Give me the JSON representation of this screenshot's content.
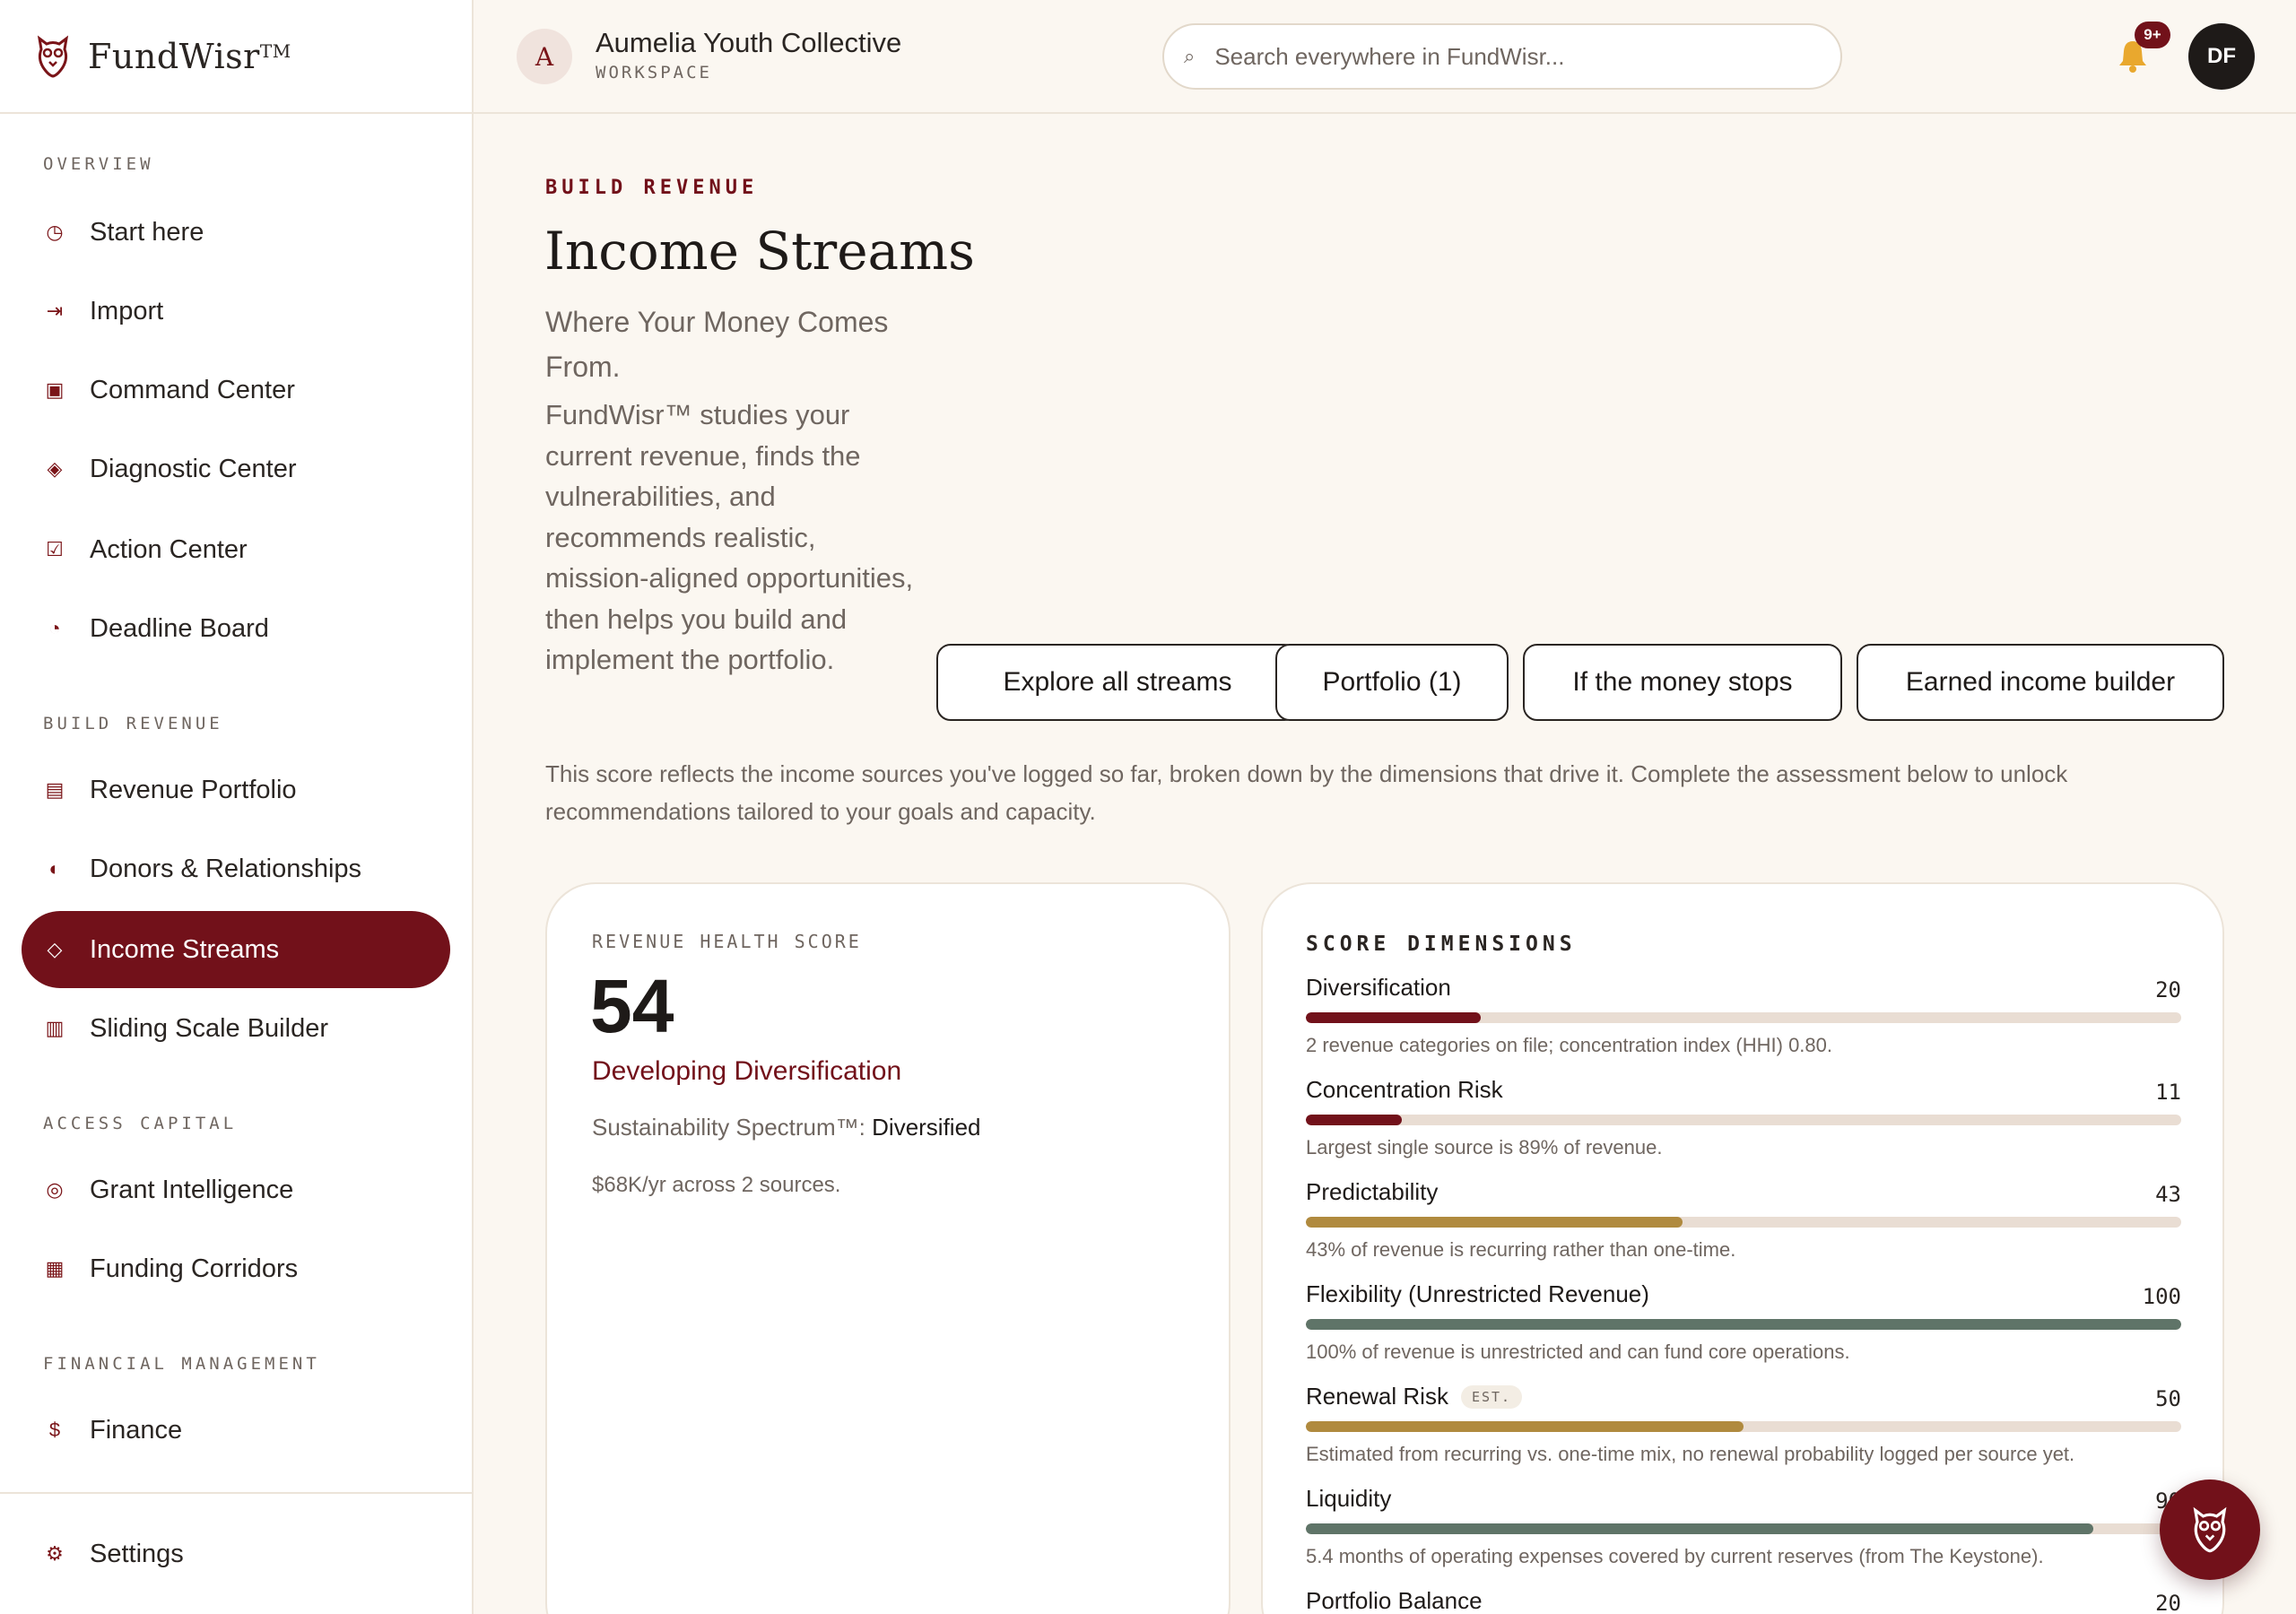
{
  "brand": {
    "name": "FundWisr",
    "tm": "TM"
  },
  "sidebar": {
    "sections": [
      {
        "label": "OVERVIEW"
      },
      {
        "label": "BUILD REVENUE"
      },
      {
        "label": "ACCESS CAPITAL"
      },
      {
        "label": "FINANCIAL MANAGEMENT"
      }
    ],
    "items": [
      {
        "label": "Start here",
        "icon": "clock-icon"
      },
      {
        "label": "Import",
        "icon": "import-arrow-icon"
      },
      {
        "label": "Command Center",
        "icon": "square-icon"
      },
      {
        "label": "Diagnostic Center",
        "icon": "diamond-icon"
      },
      {
        "label": "Action Center",
        "icon": "checkbox-icon"
      },
      {
        "label": "Deadline Board",
        "icon": "pie-icon"
      },
      {
        "label": "Revenue Portfolio",
        "icon": "list-icon"
      },
      {
        "label": "Donors & Relationships",
        "icon": "half-circle-icon"
      },
      {
        "label": "Income Streams",
        "icon": "diamond-outline-icon"
      },
      {
        "label": "Sliding Scale Builder",
        "icon": "columns-icon"
      },
      {
        "label": "Grant Intelligence",
        "icon": "target-icon"
      },
      {
        "label": "Funding Corridors",
        "icon": "grid-icon"
      },
      {
        "label": "Finance",
        "icon": "dollar-icon"
      },
      {
        "label": "Settings",
        "icon": "gear-icon"
      }
    ]
  },
  "header": {
    "workspace_initial": "A",
    "workspace_name": "Aumelia Youth Collective",
    "workspace_sub": "WORKSPACE",
    "search_placeholder": "Search everywhere in FundWisr...",
    "notification_count": "9+",
    "user_initials": "DF"
  },
  "main": {
    "eyebrow": "BUILD REVENUE",
    "title": "Income Streams",
    "subtitle": "Where Your Money Comes From.",
    "lede": "FundWisr™ studies your current revenue, finds the vulnerabilities, and recommends realistic, mission-aligned opportunities, then helps you build and implement the portfolio.",
    "actions": [
      {
        "label": "Explore all streams"
      },
      {
        "label": "Portfolio (1)"
      },
      {
        "label": "If the money stops"
      },
      {
        "label": "Earned income builder"
      }
    ],
    "intro": "This score reflects the income sources you've logged so far, broken down by the dimensions that drive it. Complete the assessment below to unlock recommendations tailored to your goals and capacity."
  },
  "revenue_health": {
    "label": "REVENUE HEALTH SCORE",
    "score": "54",
    "status": "Developing Diversification",
    "spectrum_label": "Sustainability Spectrum™:",
    "spectrum_value": "Diversified",
    "sources": "$68K/yr across 2 sources."
  },
  "score_dimensions": {
    "label": "SCORE DIMENSIONS",
    "items": [
      {
        "name": "Diversification",
        "value": "20",
        "fraction": 0.2,
        "color": "#72111a",
        "desc": "2 revenue categories on file; concentration index (HHI) 0.80.",
        "tag": ""
      },
      {
        "name": "Concentration Risk",
        "value": "11",
        "fraction": 0.11,
        "color": "#72111a",
        "desc": "Largest single source is 89% of revenue.",
        "tag": ""
      },
      {
        "name": "Predictability",
        "value": "43",
        "fraction": 0.43,
        "color": "#b08a3e",
        "desc": "43% of revenue is recurring rather than one-time.",
        "tag": ""
      },
      {
        "name": "Flexibility (Unrestricted Revenue)",
        "value": "100",
        "fraction": 1.0,
        "color": "#5f7468",
        "desc": "100% of revenue is unrestricted and can fund core operations.",
        "tag": ""
      },
      {
        "name": "Renewal Risk",
        "value": "50",
        "fraction": 0.5,
        "color": "#b08a3e",
        "desc": "Estimated from recurring vs. one-time mix, no renewal probability logged per source yet.",
        "tag": "EST."
      },
      {
        "name": "Liquidity",
        "value": "90",
        "fraction": 0.9,
        "color": "#5f7468",
        "desc": "5.4 months of operating expenses covered by current reserves (from The Keystone).",
        "tag": ""
      },
      {
        "name": "Portfolio Balance",
        "value": "20",
        "fraction": 0.2,
        "color": "#72111a",
        "desc": "",
        "tag": ""
      }
    ]
  },
  "colors": {
    "accent": "#72111a",
    "gold": "#b08a3e",
    "sage": "#5f7468",
    "background": "#fbf7f1"
  }
}
